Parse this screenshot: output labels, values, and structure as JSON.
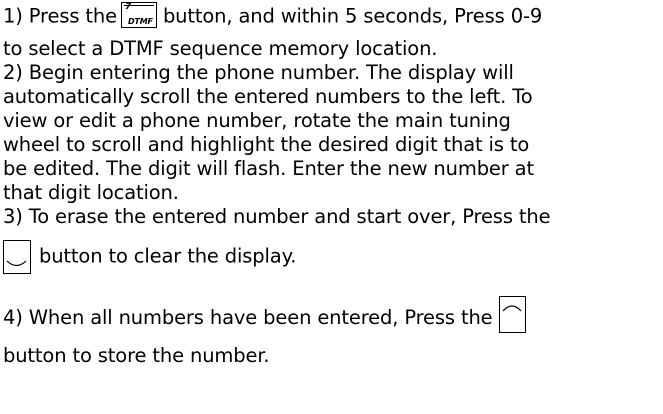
{
  "steps": {
    "s1_a": "1) Press the",
    "s1_b": "button, and within 5 seconds, Press 0-9",
    "s1_c": "to select a DTMF sequence memory location.",
    "s2_a": "2) Begin entering the phone number.  The display will",
    "s2_b": "automatically scroll the entered numbers to the left.  To",
    "s2_c": "view or edit a phone number, rotate the main tuning",
    "s2_d": "wheel to scroll and highlight the desired digit that is to",
    "s2_e": "be edited.  The digit will flash.  Enter the new number at",
    "s2_f": "that digit location.",
    "s3_a": "3) To erase the entered number and start over, Press the",
    "s3_b": "button to clear the display.",
    "s4_a": "4) When all numbers have been entered, Press the",
    "s4_b": "button to store the number."
  },
  "keys": {
    "dtmf_number": "7",
    "dtmf_label": "DTMF"
  },
  "icons": {
    "dtmf_key": "dtmf-key-icon",
    "clear_key": "clear-key-icon",
    "store_key": "store-key-icon"
  }
}
